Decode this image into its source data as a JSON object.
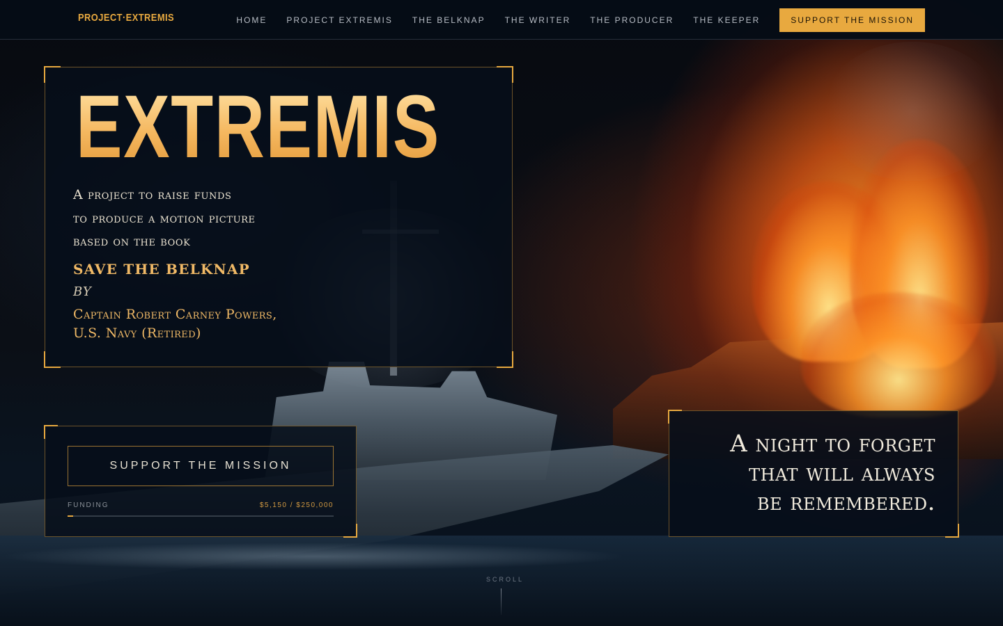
{
  "brand": {
    "name": "PROJECT·EXTREMIS"
  },
  "nav": {
    "items": [
      {
        "label": "HOME"
      },
      {
        "label": "PROJECT EXTREMIS"
      },
      {
        "label": "THE BELKNAP"
      },
      {
        "label": "THE WRITER"
      },
      {
        "label": "THE PRODUCER"
      },
      {
        "label": "THE KEEPER"
      }
    ],
    "cta_label": "SUPPORT THE MISSION"
  },
  "hero": {
    "title": "EXTREMIS",
    "lines": [
      "A project to raise funds",
      "to produce a motion picture",
      "based on the book"
    ],
    "book_title": "SAVE THE BELKNAP",
    "by": "BY",
    "author_lines": [
      "Captain Robert Carney Powers,",
      "U.S. Navy (Retired)"
    ]
  },
  "support": {
    "button_label": "SUPPORT THE MISSION",
    "funding_label": "FUNDING",
    "funding_value": "$5,150 / $250,000",
    "raised": 5150,
    "goal": 250000
  },
  "quote": {
    "lines": [
      "A night to forget",
      "that will always",
      "be remembered."
    ]
  },
  "scroll": {
    "label": "SCROLL"
  },
  "colors": {
    "accent": "#e8a93f",
    "panel_bg": "#06101c",
    "nav_bg": "#050c16"
  }
}
